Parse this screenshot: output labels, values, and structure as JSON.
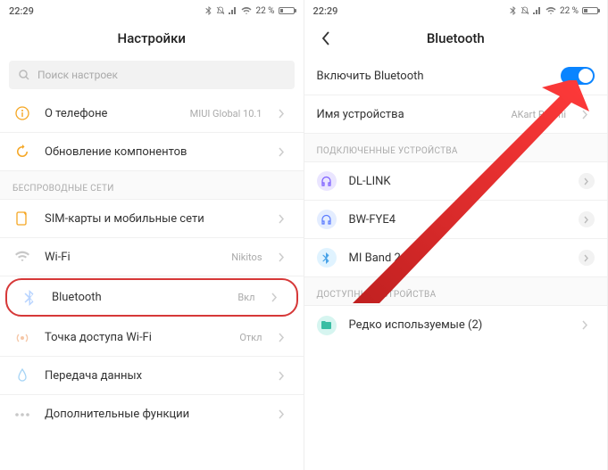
{
  "left": {
    "status": {
      "time": "22:29",
      "battery_pct": "22 %"
    },
    "title": "Настройки",
    "search_placeholder": "Поиск настроек",
    "rows": [
      {
        "label": "О телефоне",
        "value": "MIUI Global 10.1"
      },
      {
        "label": "Обновление компонентов",
        "value": ""
      }
    ],
    "section_wireless": "БЕСПРОВОДНЫЕ СЕТИ",
    "wireless_rows": [
      {
        "label": "SIM-карты и мобильные сети",
        "value": ""
      },
      {
        "label": "Wi-Fi",
        "value": "Nikitos"
      },
      {
        "label": "Bluetooth",
        "value": "Вкл"
      },
      {
        "label": "Точка доступа Wi-Fi",
        "value": "Откл"
      },
      {
        "label": "Передача данных",
        "value": ""
      },
      {
        "label": "Дополнительные функции",
        "value": ""
      }
    ]
  },
  "right": {
    "status": {
      "time": "22:29",
      "battery_pct": "22 %"
    },
    "title": "Bluetooth",
    "enable_label": "Включить Bluetooth",
    "device_name_label": "Имя устройства",
    "device_name_value": "AKart Redmi",
    "section_connected": "ПОДКЛЮЧЕННЫЕ УСТРОЙСТВА",
    "connected": [
      {
        "label": "DL-LINK"
      },
      {
        "label": "BW-FYE4"
      },
      {
        "label": "MI Band 2"
      }
    ],
    "section_available": "ДОСТУПНЫЕ УСТРОЙСТВА",
    "available": [
      {
        "label": "Редко используемые (2)"
      }
    ]
  }
}
